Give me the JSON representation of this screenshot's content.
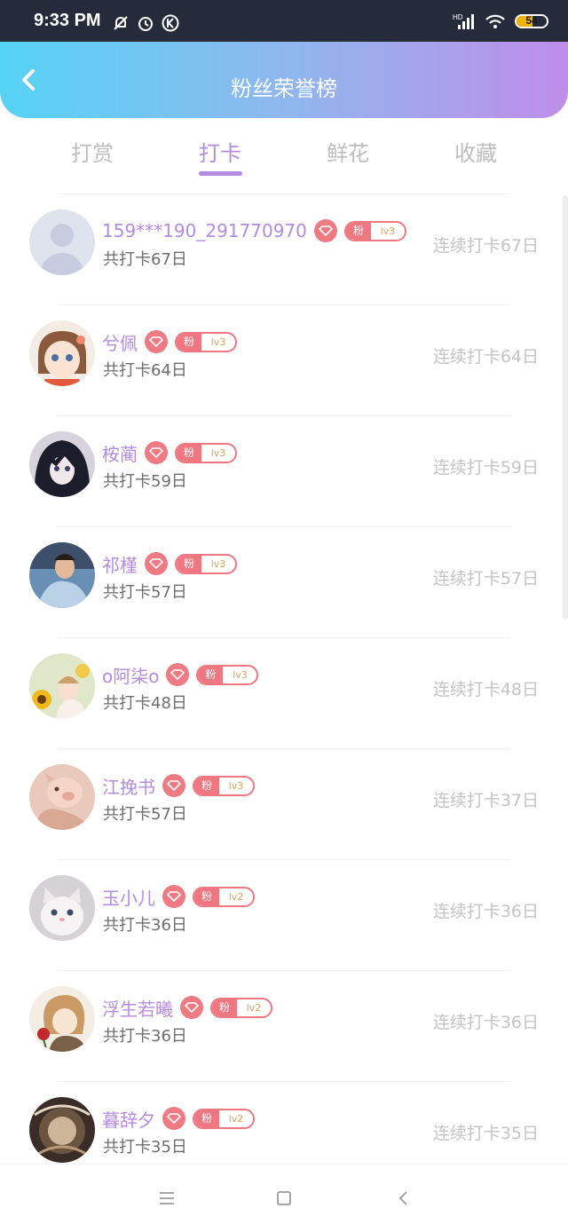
{
  "status_bar": {
    "time": "9:33 PM",
    "network": "HD",
    "battery": "54",
    "battery_level": 0.54
  },
  "header": {
    "title": "粉丝荣誉榜"
  },
  "tabs": [
    {
      "label": "打赏",
      "active": false
    },
    {
      "label": "打卡",
      "active": true
    },
    {
      "label": "鲜花",
      "active": false
    },
    {
      "label": "收藏",
      "active": false
    }
  ],
  "fan_badge_label": "粉",
  "colors": {
    "accent": "#b58be0",
    "badge": "#ef7782",
    "header_start": "#55d3f4",
    "header_end": "#bf8ee9"
  },
  "rows": [
    {
      "name": "159***190_291770970",
      "level": "lv3",
      "total": "共打卡67日",
      "streak": "连续打卡67日",
      "avatar": "default-avatar"
    },
    {
      "name": "兮佩",
      "level": "lv3",
      "total": "共打卡64日",
      "streak": "连续打卡64日",
      "avatar": "anime-girl-avatar"
    },
    {
      "name": "桉蔺",
      "level": "lv3",
      "total": "共打卡59日",
      "streak": "连续打卡59日",
      "avatar": "dark-anime-avatar"
    },
    {
      "name": "祁槿",
      "level": "lv3",
      "total": "共打卡57日",
      "streak": "连续打卡57日",
      "avatar": "boy-photo-avatar"
    },
    {
      "name": "o阿柒o",
      "level": "lv3",
      "total": "共打卡48日",
      "streak": "连续打卡48日",
      "avatar": "sunflower-avatar"
    },
    {
      "name": "江挽书",
      "level": "lv3",
      "total": "共打卡57日",
      "streak": "连续打卡37日",
      "avatar": "pig-avatar"
    },
    {
      "name": "玉小儿",
      "level": "lv2",
      "total": "共打卡36日",
      "streak": "连续打卡36日",
      "avatar": "kitten-avatar"
    },
    {
      "name": "浮生若曦",
      "level": "lv2",
      "total": "共打卡36日",
      "streak": "连续打卡36日",
      "avatar": "anime-rose-avatar"
    },
    {
      "name": "暮辞夕",
      "level": "lv2",
      "total": "共打卡35日",
      "streak": "连续打卡35日",
      "avatar": "dark-art-avatar"
    }
  ]
}
